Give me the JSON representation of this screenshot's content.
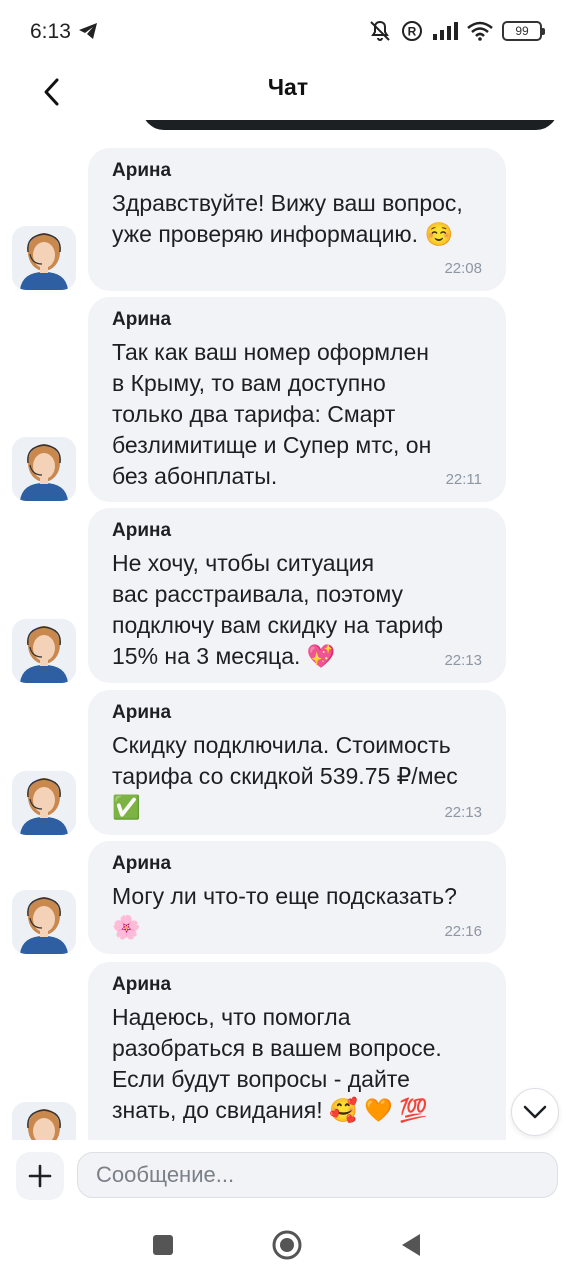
{
  "status_bar": {
    "time": "6:13",
    "battery": "99",
    "icons": [
      "telegram-icon",
      "mute-icon",
      "registered-icon",
      "signal-icon",
      "wifi-icon",
      "battery-icon"
    ]
  },
  "header": {
    "title": "Чат",
    "back_icon": "chevron-left-icon"
  },
  "messages": [
    {
      "sender": "Арина",
      "text": "Здравствуйте! Вижу ваш вопрос,\nуже проверяю информацию. ☺️",
      "time": "22:08"
    },
    {
      "sender": "Арина",
      "text": "Так как ваш номер оформлен\nв Крыму, то вам доступно\nтолько два тарифа: Смарт\nбезлимитище и Супер мтс, он\nбез абонплаты.",
      "time": "22:11"
    },
    {
      "sender": "Арина",
      "text": "Не хочу, чтобы ситуация\nвас расстраивала, поэтому\nподключу вам скидку на тариф\n15% на 3 месяца. 💖",
      "time": "22:13"
    },
    {
      "sender": "Арина",
      "text": "Скидку подключила. Стоимость\nтарифа со скидкой 539.75 ₽/мес\n✅",
      "time": "22:13"
    },
    {
      "sender": "Арина",
      "text": "Могу ли что-то еще подсказать?\n🌸",
      "time": "22:16"
    },
    {
      "sender": "Арина",
      "text": "Надеюсь, что помогла\nразобраться в вашем вопросе.\nЕсли будут вопросы - дайте\nзнать, до свидания! 🥰 🧡 💯",
      "time": ""
    }
  ],
  "composer": {
    "placeholder": "Сообщение..."
  },
  "colors": {
    "bubble": "#f2f3f7",
    "text": "#1d2023",
    "time": "#8d96a3"
  }
}
